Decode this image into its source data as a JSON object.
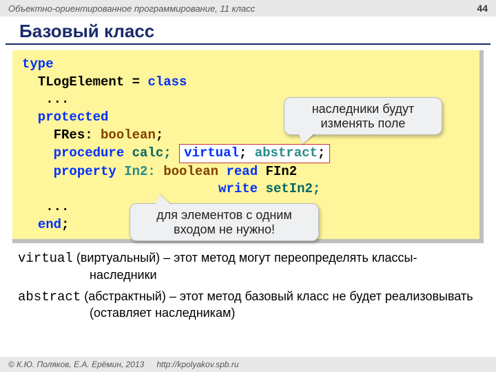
{
  "header": {
    "course": "Объектно-ориентированное программирование, 11 класс",
    "page": "44"
  },
  "title": "Базовый класс",
  "code": {
    "l1": "type",
    "l2a": "  ",
    "l2b": "TLogElement",
    "l2c": " = ",
    "l2d": "class",
    "l3": "   ...",
    "l4": "  protected",
    "l5a": "    FRes: ",
    "l5b": "boolean",
    "l5c": ";",
    "l6a": "    ",
    "l6b": "procedure",
    "l6c": " calc; ",
    "l6_box_virtual": "virtual",
    "l6_box_sep": "; ",
    "l6_box_abstract": "abstract",
    "l6_box_end": ";",
    "l7a": "    ",
    "l7b": "property",
    "l7c": " In2: ",
    "l7d": "boolean",
    "l7e": " ",
    "l7f": "read",
    "l7g": " FIn2",
    "l8a": "                         ",
    "l8b": "write",
    "l8c": " setIn2;",
    "l9": "   ...",
    "l10a": "  ",
    "l10b": "end",
    "l10c": ";"
  },
  "callout1": {
    "line1": "наследники будут",
    "line2": "изменять поле"
  },
  "callout2": {
    "line1": "для элементов с одним",
    "line2": "входом не нужно!"
  },
  "explain1": {
    "kw": "virtual",
    "rest": " (виртуальный) – этот метод могут переопределять классы-наследники"
  },
  "explain2": {
    "kw": "abstract",
    "rest": " (абстрактный) – этот метод базовый класс не будет реализовывать (оставляет наследникам)"
  },
  "footer": {
    "copyright": "© К.Ю. Поляков, Е.А. Ерёмин, 2013",
    "url": "http://kpolyakov.spb.ru"
  }
}
